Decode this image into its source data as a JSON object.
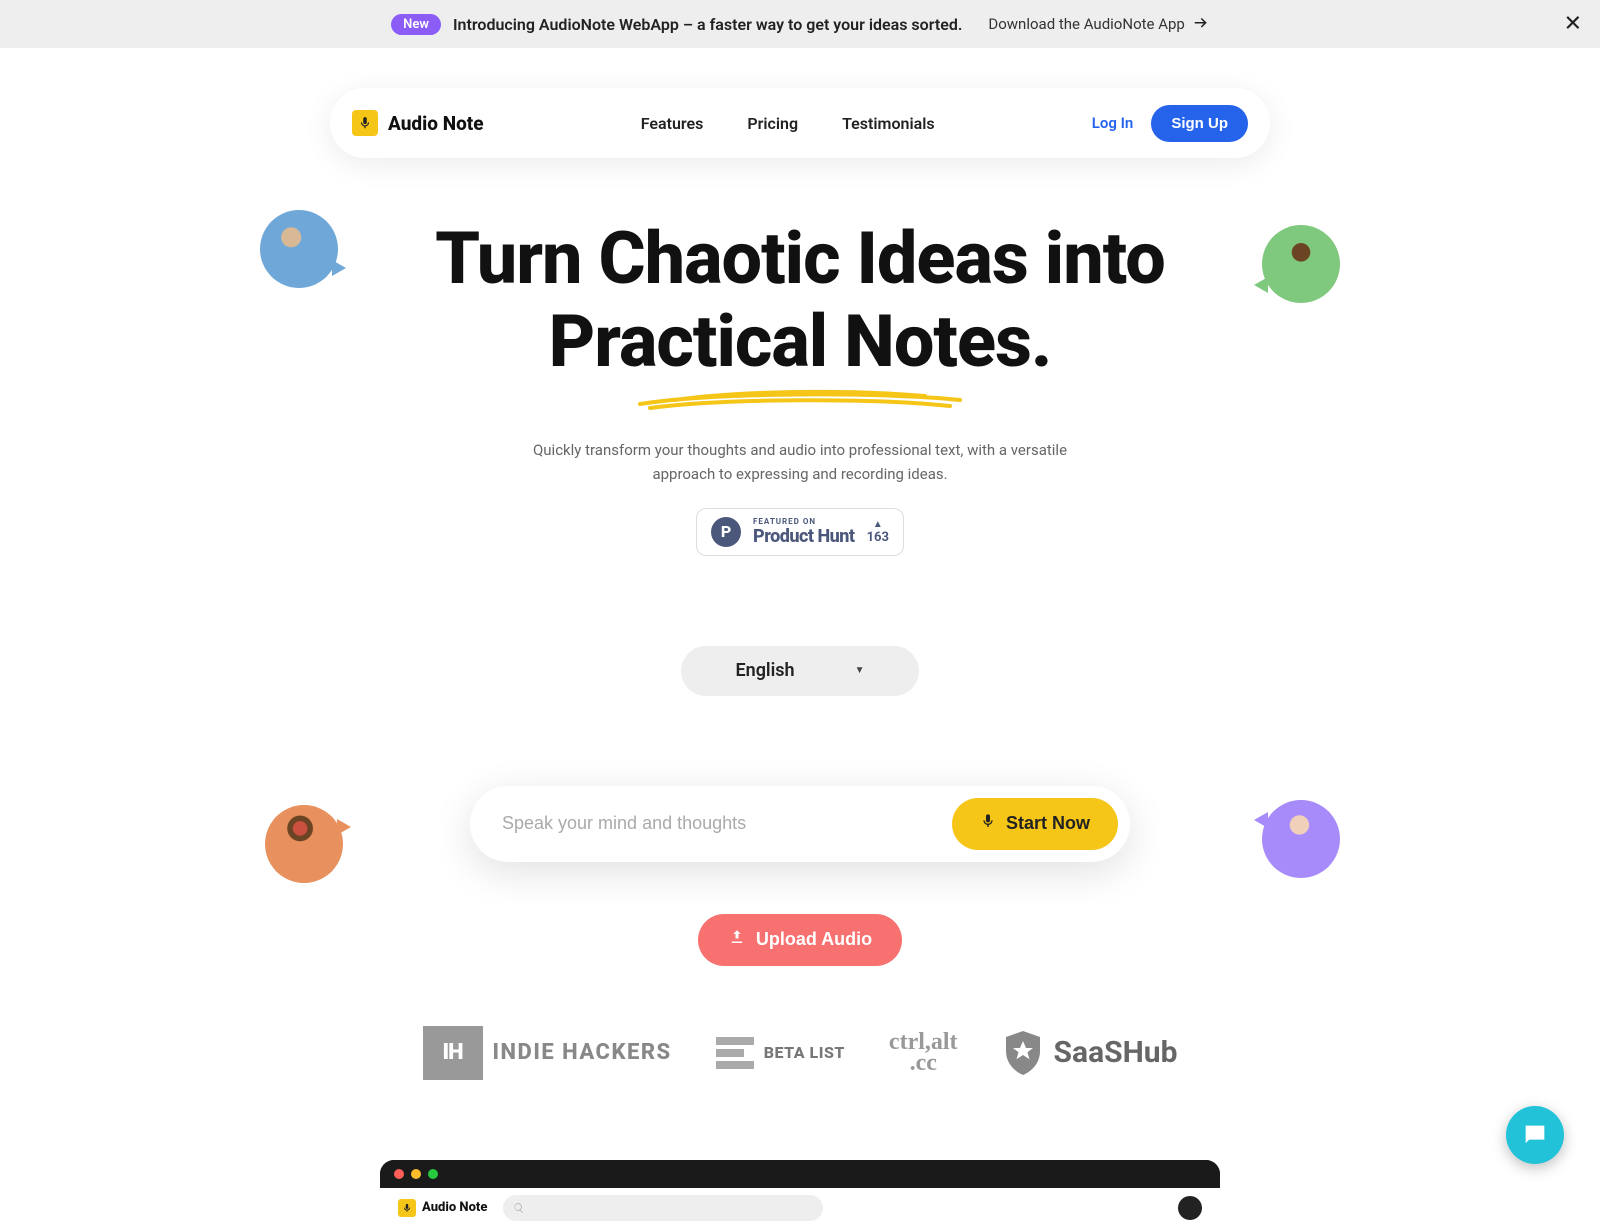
{
  "announce": {
    "badge": "New",
    "text": "Introducing AudioNote WebApp – a faster way to get your ideas sorted.",
    "link": "Download the AudioNote App"
  },
  "brand": {
    "name": "Audio Note"
  },
  "nav": {
    "features": "Features",
    "pricing": "Pricing",
    "testimonials": "Testimonials",
    "login": "Log In",
    "signup": "Sign Up"
  },
  "hero": {
    "line1": "Turn Chaotic Ideas into",
    "line2": "Practical Notes.",
    "subtext": "Quickly transform your thoughts and audio into professional text, with a versatile approach to expressing and recording ideas."
  },
  "producthunt": {
    "featured": "FEATURED ON",
    "name": "Product Hunt",
    "votes": "163"
  },
  "language": {
    "selected": "English"
  },
  "input": {
    "placeholder": "Speak your mind and thoughts",
    "start": "Start Now"
  },
  "upload": {
    "label": "Upload Audio"
  },
  "logos": {
    "ih_abbr": "IH",
    "ih": "INDIE HACKERS",
    "beta": "BETA LIST",
    "ctrl_l1": "ctrl,alt",
    "ctrl_l2": ".cc",
    "saas": "SaaSHub"
  },
  "preview": {
    "brand": "Audio Note"
  },
  "colors": {
    "accent_yellow": "#f5c518",
    "accent_blue": "#2563eb",
    "accent_purple": "#8b5cf6",
    "upload_orange": "#f87171",
    "chat_teal": "#22c3d8"
  }
}
